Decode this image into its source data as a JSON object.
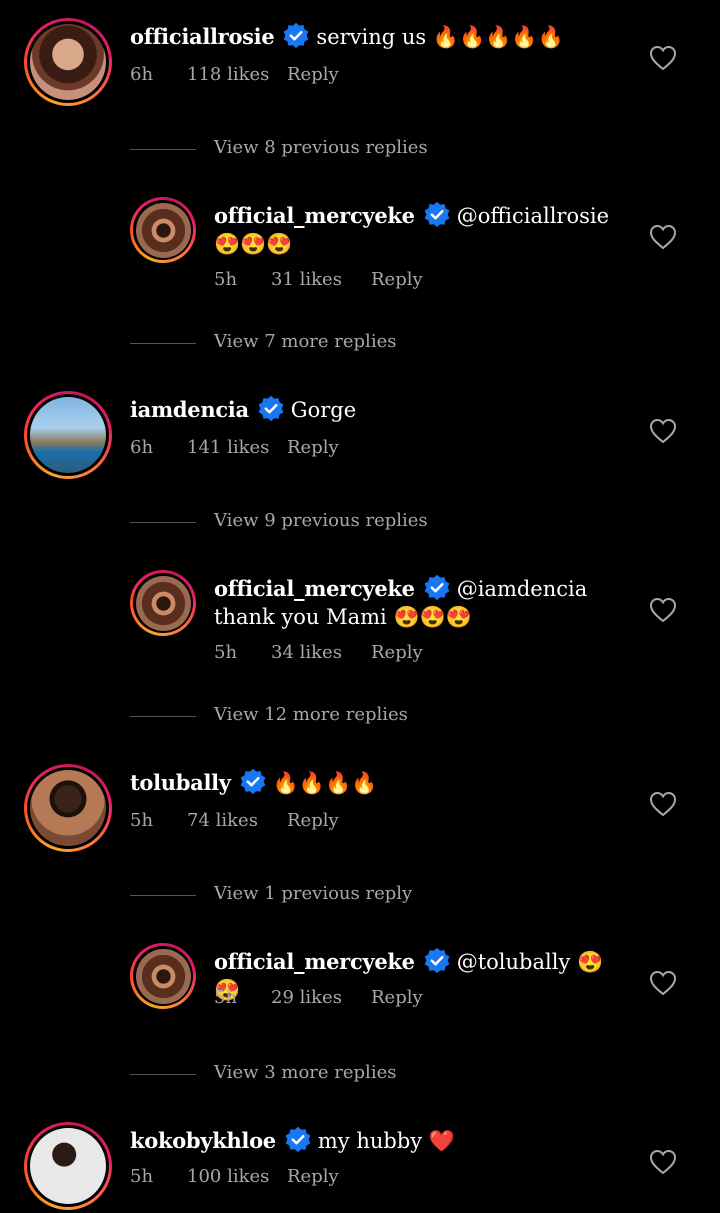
{
  "threads": [
    {
      "comment": {
        "username": "officiallrosie",
        "text": "serving us 🔥🔥🔥🔥🔥",
        "time": "6h",
        "likes": "118 likes",
        "reply_label": "Reply"
      },
      "view_previous": "View 8 previous replies",
      "reply": {
        "username": "official_mercyeke",
        "text": "@officiallrosie 😍😍😍",
        "time": "5h",
        "likes": "31 likes",
        "reply_label": "Reply"
      },
      "view_more": "View 7 more replies"
    },
    {
      "comment": {
        "username": "iamdencia",
        "text": "Gorge",
        "time": "6h",
        "likes": "141 likes",
        "reply_label": "Reply"
      },
      "view_previous": "View 9 previous replies",
      "reply": {
        "username": "official_mercyeke",
        "text": "@iamdencia thank you Mami 😍😍😍",
        "time": "5h",
        "likes": "34 likes",
        "reply_label": "Reply"
      },
      "view_more": "View 12 more replies"
    },
    {
      "comment": {
        "username": "tolubally",
        "text": "🔥🔥🔥🔥",
        "time": "5h",
        "likes": "74 likes",
        "reply_label": "Reply"
      },
      "view_previous": "View 1 previous reply",
      "reply": {
        "username": "official_mercyeke",
        "text": "@tolubally 😍😍",
        "time": "5h",
        "likes": "29 likes",
        "reply_label": "Reply"
      },
      "view_more": "View 3 more replies"
    },
    {
      "comment": {
        "username": "kokobykhloe",
        "text": "my hubby ❤️",
        "time": "5h",
        "likes": "100 likes",
        "reply_label": "Reply"
      }
    }
  ],
  "colors": {
    "background": "#000000",
    "text": "#ffffff",
    "meta": "#a8a8a8",
    "verified": "#1877f2"
  }
}
